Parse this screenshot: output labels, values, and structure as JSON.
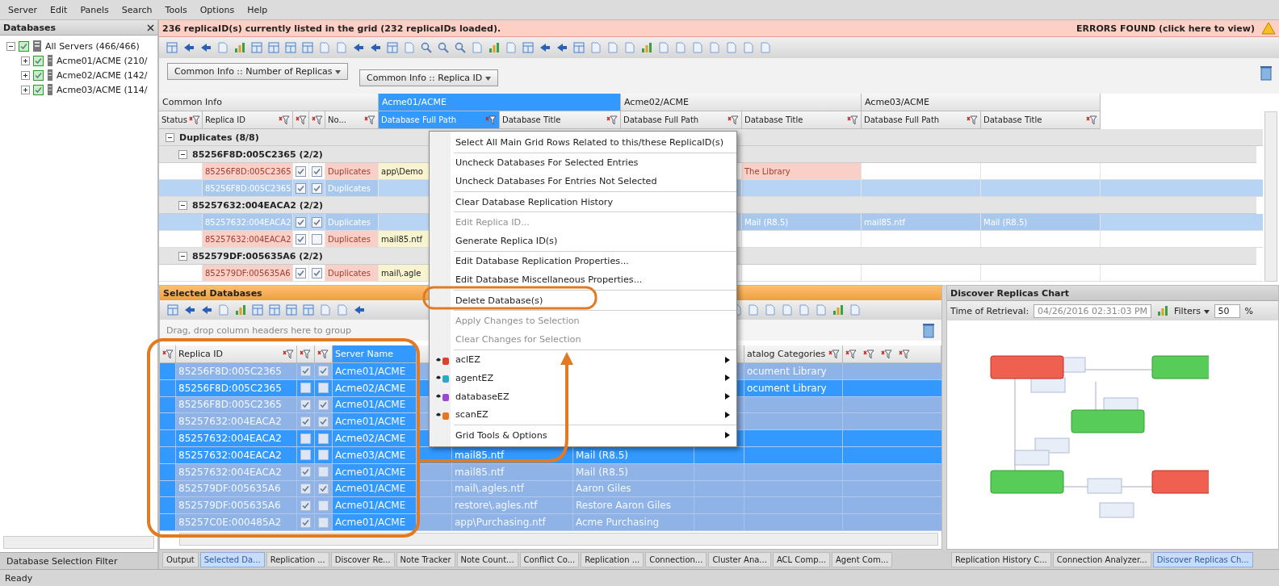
{
  "menu_bar": [
    "Server",
    "Edit",
    "Panels",
    "Search",
    "Tools",
    "Options",
    "Help"
  ],
  "databases_panel": {
    "title": "Databases",
    "tree": [
      {
        "label": "All Servers (466/466)",
        "checked": true,
        "expanded": true,
        "children": [
          {
            "label": "Acme01/ACME (210/",
            "checked": true,
            "expanded": false
          },
          {
            "label": "Acme02/ACME (142/",
            "checked": true,
            "expanded": false
          },
          {
            "label": "Acme03/ACME (114/",
            "checked": true,
            "expanded": false
          }
        ]
      }
    ],
    "filter_label": "Database Selection Filter"
  },
  "banner": {
    "message": "236 replicaID(s) currently listed in the grid (232 replicaIDs loaded).",
    "errors_link": "ERRORS FOUND (click here to view)"
  },
  "group_chips": [
    "Common Info :: Number of Replicas",
    "Common Info :: Replica ID"
  ],
  "main_grid": {
    "bands": [
      {
        "label": "Common Info",
        "selected": false
      },
      {
        "label": "Acme01/ACME",
        "selected": true
      },
      {
        "label": "Acme02/ACME",
        "selected": false
      },
      {
        "label": "Acme03/ACME",
        "selected": false
      }
    ],
    "columns": [
      {
        "kind": "text",
        "label": "Status",
        "selected": false
      },
      {
        "kind": "text",
        "label": "Replica ID",
        "selected": false
      },
      {
        "kind": "check",
        "selected": false
      },
      {
        "kind": "check",
        "selected": false
      },
      {
        "kind": "text",
        "label": "No...",
        "selected": false
      },
      {
        "kind": "text",
        "label": "Database Full Path",
        "selected": true
      },
      {
        "kind": "text",
        "label": "Database Title",
        "selected": false
      },
      {
        "kind": "text",
        "label": "Database Full Path",
        "selected": false
      },
      {
        "kind": "text",
        "label": "Database Title",
        "selected": false
      },
      {
        "kind": "text",
        "label": "Database Full Path",
        "selected": false
      },
      {
        "kind": "text",
        "label": "Database Title",
        "selected": false
      }
    ],
    "groups": [
      {
        "label": "Duplicates (8/8)",
        "expanded": true,
        "children": [
          {
            "label": "85256F8D:005C2365 (2/2)",
            "expanded": true,
            "rows": [
              {
                "selected": false,
                "replica_id": "85256F8D:005C2365",
                "check_1": true,
                "check_2": true,
                "status": "Duplicates",
                "path_1": "app\\Demo",
                "title_2": "The Library"
              },
              {
                "selected": true,
                "replica_id": "85256F8D:005C2365",
                "check_1": true,
                "check_2": true,
                "status": "Duplicates"
              }
            ]
          },
          {
            "label": "85257632:004EACA2 (2/2)",
            "expanded": true,
            "rows": [
              {
                "selected": true,
                "replica_id": "85257632:004EACA2",
                "check_1": true,
                "check_2": true,
                "status": "Duplicates",
                "title_2": "Mail (R8.5)",
                "path_3": "mail85.ntf",
                "title_3": "Mail (R8.5)"
              },
              {
                "selected": false,
                "replica_id": "85257632:004EACA2",
                "check_1": true,
                "check_2": false,
                "status": "Duplicates",
                "path_1": "mail85.ntf"
              }
            ]
          },
          {
            "label": "852579DF:005635A6 (2/2)",
            "expanded": true,
            "rows": [
              {
                "selected": false,
                "replica_id": "852579DF:005635A6",
                "check_1": true,
                "check_2": true,
                "status": "Duplicates",
                "path_1": "mail\\.agle"
              }
            ]
          }
        ]
      }
    ]
  },
  "selected_databases": {
    "title": "Selected Databases",
    "group_hint": "Drag, drop column headers here to group",
    "columns": [
      {
        "kind": "filter",
        "selected": false
      },
      {
        "kind": "text",
        "label": "Replica ID",
        "selected": false
      },
      {
        "kind": "check",
        "selected": false
      },
      {
        "kind": "check",
        "selected": false
      },
      {
        "kind": "text",
        "label": "Server Name",
        "selected": true
      },
      {
        "kind": "text",
        "label": "atalog Categories",
        "selected": false
      }
    ],
    "rows": [
      {
        "selected": false,
        "replica_id": "85256F8D:005C2365",
        "check_1": true,
        "check_2": true,
        "server": "Acme01/ACME",
        "catalog": "ocument Library"
      },
      {
        "selected": true,
        "replica_id": "85256F8D:005C2365",
        "check_1": false,
        "check_2": false,
        "server": "Acme02/ACME",
        "catalog": "ocument Library"
      },
      {
        "selected": false,
        "replica_id": "85256F8D:005C2365",
        "check_1": true,
        "check_2": true,
        "server": "Acme01/ACME"
      },
      {
        "selected": false,
        "replica_id": "85257632:004EACA2",
        "check_1": true,
        "check_2": true,
        "server": "Acme01/ACME"
      },
      {
        "selected": true,
        "replica_id": "85257632:004EACA2",
        "check_1": false,
        "check_2": false,
        "server": "Acme02/ACME"
      },
      {
        "selected": true,
        "replica_id": "85257632:004EACA2",
        "check_1": false,
        "check_2": false,
        "server": "Acme03/ACME",
        "path": "mail85.ntf",
        "title": "Mail (R8.5)"
      },
      {
        "selected": false,
        "replica_id": "85257632:004EACA2",
        "check_1": true,
        "check_2": false,
        "server": "Acme01/ACME",
        "path": "mail85.ntf",
        "title": "Mail (R8.5)"
      },
      {
        "selected": false,
        "replica_id": "852579DF:005635A6",
        "check_1": true,
        "check_2": true,
        "server": "Acme01/ACME",
        "path": "mail\\.agles.ntf",
        "title": "Aaron Giles"
      },
      {
        "selected": false,
        "replica_id": "852579DF:005635A6",
        "check_1": true,
        "check_2": false,
        "server": "Acme01/ACME",
        "path": "restore\\.agles.ntf",
        "title": "Restore Aaron Giles"
      },
      {
        "selected": false,
        "replica_id": "85257C0E:000485A2",
        "check_1": true,
        "check_2": false,
        "server": "Acme01/ACME",
        "path": "app\\Purchasing.ntf",
        "title": "Acme Purchasing"
      }
    ]
  },
  "chart_panel": {
    "title": "Discover Replicas Chart",
    "time_label": "Time of Retrieval:",
    "time_value": "04/26/2016 02:31:03 PM",
    "filters_label": "Filters",
    "zoom_value": "50",
    "zoom_unit": "%"
  },
  "context_menu": [
    {
      "kind": "item",
      "label": "Select All Main Grid Rows Related to this/these ReplicaID(s)",
      "disabled": false,
      "separator_before": false
    },
    {
      "kind": "item",
      "label": "Uncheck Databases For Selected Entries",
      "disabled": false,
      "separator_before": true
    },
    {
      "kind": "item",
      "label": "Uncheck Databases For Entries Not Selected",
      "disabled": false,
      "separator_before": false
    },
    {
      "kind": "item",
      "label": "Clear Database Replication History",
      "disabled": false,
      "separator_before": true
    },
    {
      "kind": "item",
      "label": "Edit Replica ID...",
      "disabled": true,
      "separator_before": true
    },
    {
      "kind": "item",
      "label": "Generate Replica ID(s)",
      "disabled": false,
      "separator_before": false
    },
    {
      "kind": "item",
      "label": "Edit Database Replication Properties...",
      "disabled": false,
      "separator_before": true
    },
    {
      "kind": "item",
      "label": "Edit Database Miscellaneous Properties...",
      "disabled": false,
      "separator_before": false
    },
    {
      "kind": "item",
      "label": "Delete Database(s)",
      "disabled": false,
      "separator_before": true
    },
    {
      "kind": "item",
      "label": "Apply Changes to Selection",
      "disabled": true,
      "separator_before": true
    },
    {
      "kind": "item",
      "label": "Clear Changes for Selection",
      "disabled": true,
      "separator_before": false
    },
    {
      "kind": "submenu",
      "label": "aclEZ",
      "disabled": false,
      "separator_before": true,
      "color": "#e0402a"
    },
    {
      "kind": "submenu",
      "label": "agentEZ",
      "disabled": false,
      "separator_before": false,
      "color": "#2aa8c8"
    },
    {
      "kind": "submenu",
      "label": "databaseEZ",
      "disabled": false,
      "separator_before": false,
      "color": "#9a4ad0"
    },
    {
      "kind": "submenu",
      "label": "scanEZ",
      "disabled": false,
      "separator_before": false,
      "color": "#e8761c"
    },
    {
      "kind": "submenu",
      "label": "Grid Tools & Options",
      "disabled": false,
      "separator_before": true
    }
  ],
  "bottom_tabs_left": [
    {
      "label": "Output",
      "selected": false
    },
    {
      "label": "Selected Da...",
      "selected": true
    },
    {
      "label": "Replication ...",
      "selected": false
    },
    {
      "label": "Discover Re...",
      "selected": false
    },
    {
      "label": "Note Tracker",
      "selected": false
    },
    {
      "label": "Note Count...",
      "selected": false
    },
    {
      "label": "Conflict Co...",
      "selected": false
    },
    {
      "label": "Replication ...",
      "selected": false
    },
    {
      "label": "Connection...",
      "selected": false
    },
    {
      "label": "Cluster Ana...",
      "selected": false
    },
    {
      "label": "ACL Comp...",
      "selected": false
    },
    {
      "label": "Agent Com...",
      "selected": false
    }
  ],
  "bottom_tabs_right": [
    {
      "label": "Replication History C...",
      "selected": false
    },
    {
      "label": "Connection Analyzer...",
      "selected": false
    },
    {
      "label": "Discover Replicas Ch...",
      "selected": true
    }
  ],
  "status_bar": "Ready"
}
